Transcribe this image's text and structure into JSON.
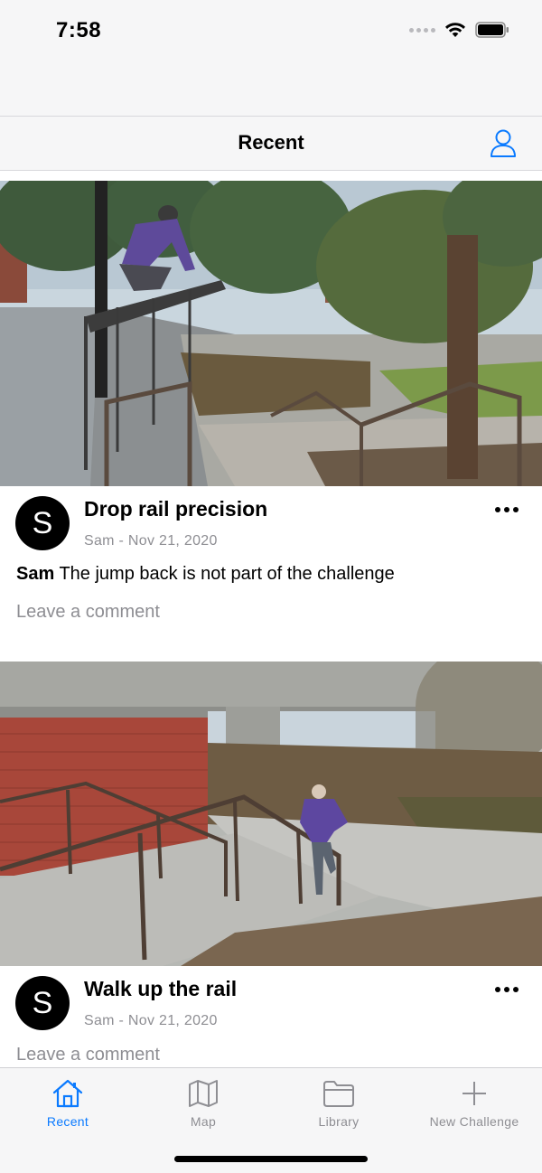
{
  "status_bar": {
    "time": "7:58"
  },
  "nav": {
    "title": "Recent"
  },
  "posts": [
    {
      "title": "Drop rail precision",
      "avatar_letter": "S",
      "meta": "Sam - Nov 21, 2020",
      "caption_user": "Sam",
      "caption_text": "The jump back is not part of the challenge",
      "comment_placeholder": "Leave a comment"
    },
    {
      "title": "Walk up the rail",
      "avatar_letter": "S",
      "meta": "Sam - Nov 21, 2020",
      "comment_placeholder": "Leave a comment"
    }
  ],
  "tabs": [
    {
      "label": "Recent",
      "icon": "home-icon",
      "active": true
    },
    {
      "label": "Map",
      "icon": "map-icon",
      "active": false
    },
    {
      "label": "Library",
      "icon": "folder-icon",
      "active": false
    },
    {
      "label": "New Challenge",
      "icon": "plus-icon",
      "active": false
    }
  ],
  "colors": {
    "accent": "#0a7aff",
    "secondary_text": "#8e8e93",
    "bar_bg": "#f6f6f7"
  }
}
